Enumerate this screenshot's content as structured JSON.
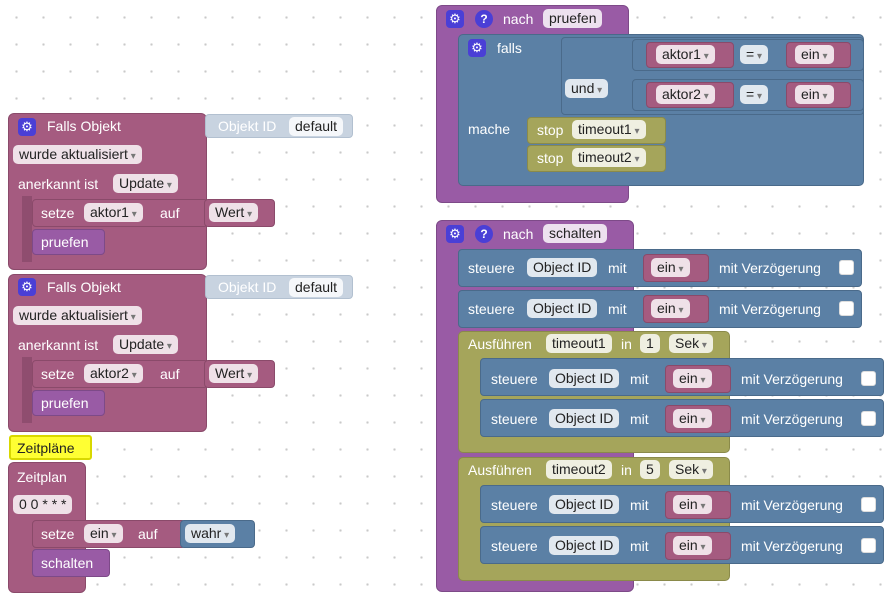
{
  "trigger1": {
    "title": "Falls Objekt",
    "object_label": "Objekt ID",
    "object_value": "default",
    "event": "wurde aktualisiert",
    "ack_label": "anerkannt ist",
    "ack_value": "Update",
    "set_label": "setze",
    "var": "aktor1",
    "on_label": "auf",
    "value": "Wert",
    "call": "pruefen"
  },
  "trigger2": {
    "title": "Falls Objekt",
    "object_label": "Objekt ID",
    "object_value": "default",
    "event": "wurde aktualisiert",
    "ack_label": "anerkannt ist",
    "ack_value": "Update",
    "set_label": "setze",
    "var": "aktor2",
    "on_label": "auf",
    "value": "Wert",
    "call": "pruefen"
  },
  "schedule": {
    "comment": "Zeitpläne",
    "label": "Zeitplan",
    "cron": "0 0 * * *",
    "set_label": "setze",
    "var": "ein",
    "on_label": "auf",
    "value": "wahr",
    "call": "schalten"
  },
  "proc1": {
    "prefix": "nach",
    "name": "pruefen",
    "if_label": "falls",
    "and_label": "und",
    "do_label": "mache",
    "cond1": {
      "var": "aktor1",
      "op": "=",
      "val": "ein"
    },
    "cond2": {
      "var": "aktor2",
      "op": "=",
      "val": "ein"
    },
    "stop_label": "stop",
    "timer1": "timeout1",
    "timer2": "timeout2"
  },
  "proc2": {
    "prefix": "nach",
    "name": "schalten",
    "control_label": "steuere",
    "object_label": "Object ID",
    "with_label": "mit",
    "val": "ein",
    "delay_label": "mit Verzögerung",
    "exec_label": "Ausführen",
    "in_label": "in",
    "unit": "Sek",
    "timer1": "timeout1",
    "delay1": "1",
    "timer2": "timeout2",
    "delay2": "5"
  }
}
